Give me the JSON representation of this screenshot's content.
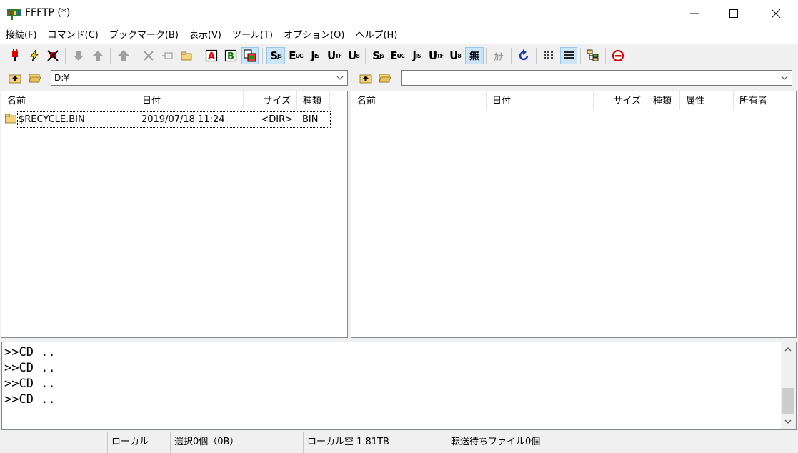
{
  "window": {
    "title": "FFFTP (*)"
  },
  "menu": [
    "接続(F)",
    "コマンド(C)",
    "ブックマーク(B)",
    "表示(V)",
    "ツール(T)",
    "オプション(O)",
    "ヘルプ(H)"
  ],
  "toolbar": {
    "encodings_local": {
      "s": "S",
      "e": "E",
      "j": "J",
      "u1": "U",
      "u2": "U"
    },
    "encodings_remote": {
      "s": "S",
      "e": "E",
      "j": "J",
      "u1": "U",
      "u2": "U"
    },
    "mu_label": "無",
    "kana_label": "ｶﾅ",
    "ascii_label": "A",
    "binary_label": "B"
  },
  "local": {
    "path": "D:¥",
    "headers": {
      "name": "名前",
      "date": "日付",
      "size": "サイズ",
      "type": "種類"
    },
    "files": [
      {
        "name": "$RECYCLE.BIN",
        "date": "2019/07/18 11:24",
        "size": "<DIR>",
        "type": "BIN"
      }
    ]
  },
  "remote": {
    "path": "",
    "headers": {
      "name": "名前",
      "date": "日付",
      "size": "サイズ",
      "type": "種類",
      "attr": "属性",
      "owner": "所有者"
    }
  },
  "log": [
    ">>CD ..",
    ">>CD ..",
    ">>CD ..",
    ">>CD .."
  ],
  "status": {
    "location": "ローカル",
    "selection": "選択0個（0B）",
    "free": "ローカル空 1.81TB",
    "queue": "転送待ちファイル0個"
  }
}
